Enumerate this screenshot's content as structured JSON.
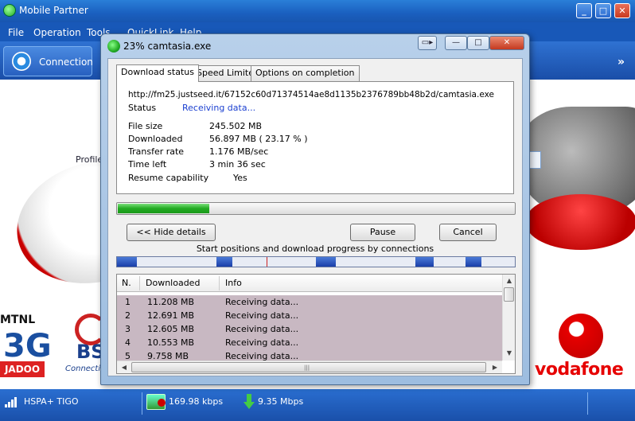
{
  "app": {
    "title": "Mobile Partner",
    "menu": [
      "File",
      "Operation",
      "Tools",
      "QuickLink",
      "Help"
    ],
    "toolbar": {
      "connection_label": "Connection",
      "more": "»"
    },
    "profile_label": "Profile",
    "window_buttons": {
      "minimize": "_",
      "maximize": "□",
      "close": "✕"
    }
  },
  "brands": {
    "mtnl": {
      "name": "MTNL",
      "mark": "3G",
      "tag": "JADOO"
    },
    "bsnl": {
      "name": "BS",
      "tag": "Connecti"
    },
    "vodafone": {
      "name": "vodafone"
    }
  },
  "statusbar": {
    "network": "HSPA+ TIGO",
    "upload_speed": "169.98 kbps",
    "download_speed": "9.35 Mbps"
  },
  "dialog": {
    "title": "23% camtasia.exe",
    "title_buttons": {
      "arrow": "▭▸",
      "minimize": "—",
      "maximize": "□",
      "close": "✕"
    },
    "tabs": [
      "Download status",
      "Speed Limiter",
      "Options on completion"
    ],
    "active_tab": "Download status",
    "url": "http://fm25.justseed.it/67152c60d71374514ae8d1135b2376789bb48b2d/camtasia.exe",
    "status_label": "Status",
    "status_value": "Receiving data...",
    "fields": [
      {
        "label": "File size",
        "value": "245.502  MB"
      },
      {
        "label": "Downloaded",
        "value": "56.897  MB  ( 23.17 % )"
      },
      {
        "label": "Transfer rate",
        "value": "1.176  MB/sec"
      },
      {
        "label": "Time left",
        "value": "3 min  36 sec"
      },
      {
        "label": "Resume capability",
        "value": "Yes"
      }
    ],
    "progress_fraction": 0.2317,
    "buttons": {
      "hide_details": "<< Hide details",
      "pause": "Pause",
      "cancel": "Cancel"
    },
    "connections_caption": "Start positions and download progress by connections",
    "connections_progress": [
      {
        "start": 0.0,
        "done": 0.05
      },
      {
        "start": 0.25,
        "done": 0.04
      },
      {
        "start": 0.5,
        "done": 0.05
      },
      {
        "start": 0.75,
        "done": 0.045
      },
      {
        "start": 0.875,
        "done": 0.04
      }
    ],
    "table": {
      "columns": [
        "N.",
        "Downloaded",
        "Info"
      ],
      "rows": [
        {
          "n": "1",
          "downloaded": "11.208  MB",
          "info": "Receiving data..."
        },
        {
          "n": "2",
          "downloaded": "12.691  MB",
          "info": "Receiving data..."
        },
        {
          "n": "3",
          "downloaded": "12.605  MB",
          "info": "Receiving data..."
        },
        {
          "n": "4",
          "downloaded": "10.553  MB",
          "info": "Receiving data..."
        },
        {
          "n": "5",
          "downloaded": "9.758  MB",
          "info": "Receiving data..."
        }
      ]
    }
  }
}
